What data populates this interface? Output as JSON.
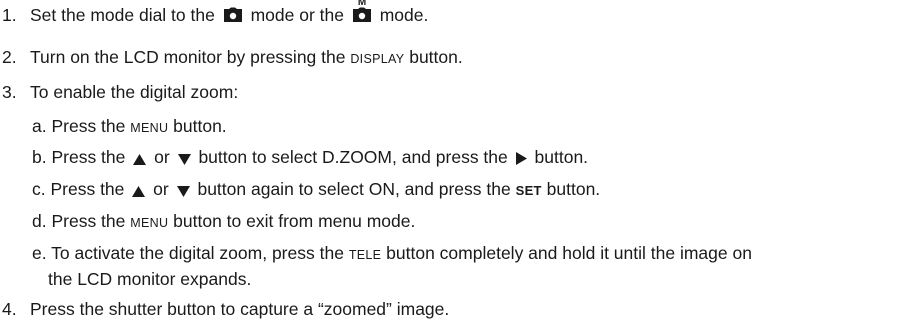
{
  "steps": [
    {
      "num": "1.",
      "text_a": "Set the mode dial to the",
      "text_b": "mode or the",
      "text_c": "mode.",
      "icon1": "camera-icon",
      "icon2": "manual-camera-icon",
      "icon2_letter": "M"
    },
    {
      "num": "2.",
      "text_a": "Turn on the LCD monitor by pressing the",
      "button": "DISPLAY",
      "text_b": "button."
    },
    {
      "num": "3.",
      "text": "To enable the digital zoom:",
      "sub": {
        "a": {
          "text_a": "a. Press the",
          "button": "MENU",
          "text_b": "button."
        },
        "b": {
          "text_a": "b. Press the",
          "text_b": "or",
          "text_c": "button to select D.ZOOM, and press the",
          "text_d": "button.",
          "icons": [
            "up-triangle-icon",
            "down-triangle-icon",
            "right-triangle-icon"
          ]
        },
        "c": {
          "text_a": "c. Press the",
          "text_b": "or",
          "text_c": "button again to select ON, and press the",
          "button": "SET",
          "text_d": "button."
        },
        "d": {
          "text_a": "d. Press the",
          "button": "MENU",
          "text_b": "button to exit from menu mode."
        },
        "e": {
          "text_a": "e. To activate the digital zoom, press the",
          "button": "TELE",
          "text_b": "button completely and hold it until the image on",
          "text_c": "the LCD monitor expands."
        }
      }
    },
    {
      "num": "4.",
      "text": "Press the shutter button to capture a “zoomed” image."
    }
  ]
}
